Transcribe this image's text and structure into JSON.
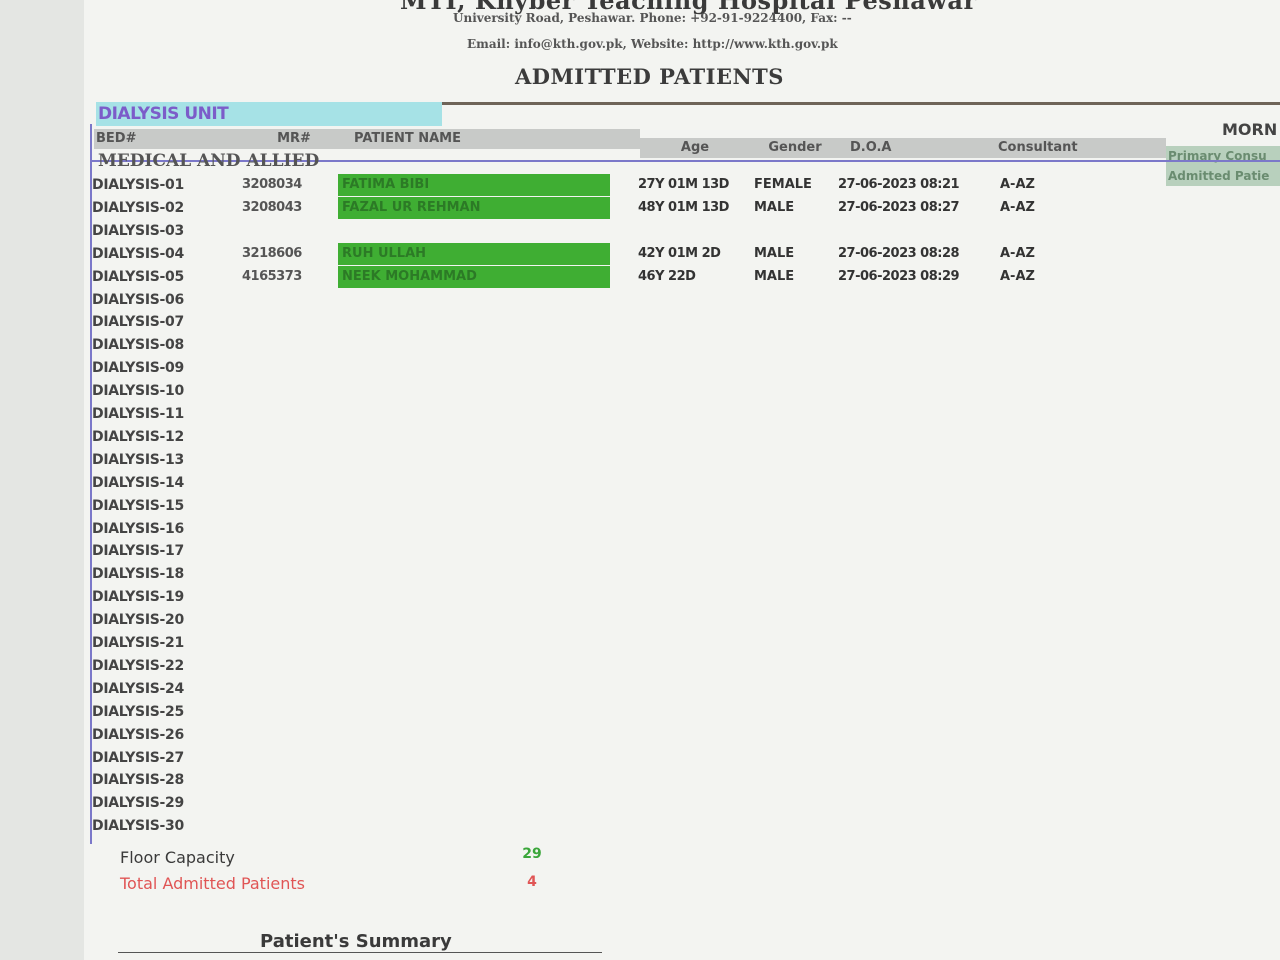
{
  "header": {
    "hospital_name": "MTI, Khyber Teaching Hospital Peshawar",
    "address": "University Road, Peshawar.  Phone: +92-91-9224400, Fax: --",
    "contact": "Email: info@kth.gov.pk, Website: http://www.kth.gov.pk",
    "heading": "ADMITTED PATIENTS"
  },
  "unit": {
    "label": "DIALYSIS UNIT",
    "section": "MEDICAL AND ALLIED"
  },
  "right_panel": {
    "title": "MORN",
    "primary": "Primary Consu",
    "admitted": "Admitted Patie"
  },
  "columns": {
    "bed": "BED#",
    "mr": "MR#",
    "patient_name": "PATIENT NAME",
    "age": "Age",
    "gender": "Gender",
    "doa": "D.O.A",
    "consultant": "Consultant"
  },
  "rows": [
    {
      "bed": "DIALYSIS-01",
      "mr": "3208034",
      "name": "FATIMA BIBI",
      "age": "27Y 01M 13D",
      "gender": "FEMALE",
      "doa": "27-06-2023 08:21",
      "consultant": "A-AZ"
    },
    {
      "bed": "DIALYSIS-02",
      "mr": "3208043",
      "name": "FAZAL UR REHMAN",
      "age": "48Y 01M 13D",
      "gender": "MALE",
      "doa": "27-06-2023 08:27",
      "consultant": "A-AZ"
    },
    {
      "bed": "DIALYSIS-03"
    },
    {
      "bed": "DIALYSIS-04",
      "mr": "3218606",
      "name": "RUH ULLAH",
      "age": "42Y 01M 2D",
      "gender": "MALE",
      "doa": "27-06-2023 08:28",
      "consultant": "A-AZ"
    },
    {
      "bed": "DIALYSIS-05",
      "mr": "4165373",
      "name": "NEEK MOHAMMAD",
      "age": "46Y 22D",
      "gender": "MALE",
      "doa": "27-06-2023 08:29",
      "consultant": "A-AZ"
    },
    {
      "bed": "DIALYSIS-06"
    },
    {
      "bed": "DIALYSIS-07"
    },
    {
      "bed": "DIALYSIS-08"
    },
    {
      "bed": "DIALYSIS-09"
    },
    {
      "bed": "DIALYSIS-10"
    },
    {
      "bed": "DIALYSIS-11"
    },
    {
      "bed": "DIALYSIS-12"
    },
    {
      "bed": "DIALYSIS-13"
    },
    {
      "bed": "DIALYSIS-14"
    },
    {
      "bed": "DIALYSIS-15"
    },
    {
      "bed": "DIALYSIS-16"
    },
    {
      "bed": "DIALYSIS-17"
    },
    {
      "bed": "DIALYSIS-18"
    },
    {
      "bed": "DIALYSIS-19"
    },
    {
      "bed": "DIALYSIS-20"
    },
    {
      "bed": "DIALYSIS-21"
    },
    {
      "bed": "DIALYSIS-22"
    },
    {
      "bed": "DIALYSIS-24"
    },
    {
      "bed": "DIALYSIS-25"
    },
    {
      "bed": "DIALYSIS-26"
    },
    {
      "bed": "DIALYSIS-27"
    },
    {
      "bed": "DIALYSIS-28"
    },
    {
      "bed": "DIALYSIS-29"
    },
    {
      "bed": "DIALYSIS-30"
    }
  ],
  "summary": {
    "floor_capacity_label": "Floor Capacity",
    "floor_capacity_value": "29",
    "total_admitted_label": "Total Admitted Patients",
    "total_admitted_value": "4",
    "patients_summary_title": "Patient's Summary"
  },
  "colors": {
    "unit_label_bg": "#a6e2e6",
    "unit_label_text": "#7c5cc9",
    "occupied_name_bg": "#3fae33",
    "floor_capacity_value": "#3aa63a",
    "total_admitted": "#e05555",
    "grid_line": "#7b78c9"
  }
}
